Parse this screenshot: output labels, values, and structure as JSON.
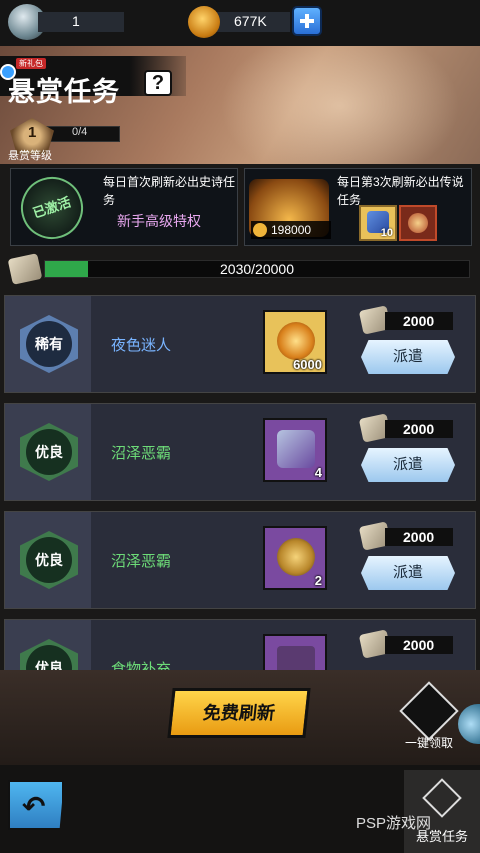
{
  "top_bar": {
    "resource1_value": "1",
    "resource2_value": "677K"
  },
  "header": {
    "new_tag": "新礼包",
    "title": "悬赏任务",
    "help": "?",
    "level": "1",
    "level_progress": "0/4",
    "level_label": "悬赏等级"
  },
  "perks": [
    {
      "stamp": "已激活",
      "text": "每日首次刷新必出史诗任务",
      "subtext": "新手高级特权"
    },
    {
      "chest_value": "198000",
      "text": "每日第3次刷新必出传说任务",
      "item_count": "10"
    }
  ],
  "progress": {
    "text": "2030/20000",
    "fraction": 0.1015
  },
  "quests": [
    {
      "rarity": "稀有",
      "name": "夜色迷人",
      "name_color": "#79b4ff",
      "reward_count": "6000",
      "cost": "2000",
      "button": "派遣"
    },
    {
      "rarity": "优良",
      "name": "沼泽恶霸",
      "name_color": "#6ddc78",
      "reward_count": "4",
      "cost": "2000",
      "button": "派遣"
    },
    {
      "rarity": "优良",
      "name": "沼泽恶霸",
      "name_color": "#6ddc78",
      "reward_count": "2",
      "cost": "2000",
      "button": "派遣"
    },
    {
      "rarity": "优良",
      "name": "食物补充",
      "name_color": "#6ddc78",
      "reward_count": "",
      "cost": "2000",
      "button": ""
    }
  ],
  "actions": {
    "refresh": "免费刷新",
    "collect_all": "一键领取"
  },
  "footer": {
    "tab_label": "悬赏任务",
    "watermark": "PSP游戏网"
  }
}
